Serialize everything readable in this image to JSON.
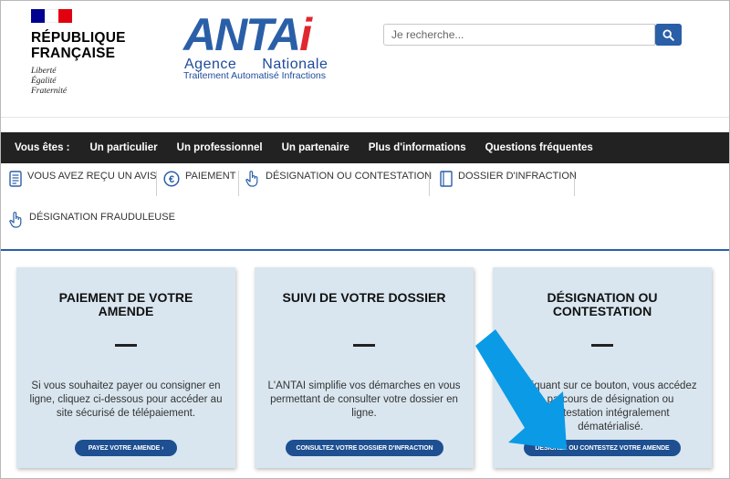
{
  "header": {
    "republique": {
      "line1": "RÉPUBLIQUE",
      "line2": "FRANÇAISE",
      "motto": [
        "Liberté",
        "Égalité",
        "Fraternité"
      ],
      "flag_colors": [
        "#000091",
        "#ffffff",
        "#e1000f"
      ]
    },
    "antai": {
      "word_blue": "ANTA",
      "word_red": "i",
      "sub1_a": "Agence",
      "sub1_b": "Nationale",
      "sub2": "Traitement Automatisé Infractions"
    },
    "search": {
      "placeholder": "Je recherche...",
      "icon": "search-icon"
    }
  },
  "topnav": {
    "label": "Vous êtes :",
    "items": [
      "Un particulier",
      "Un professionnel",
      "Un partenaire",
      "Plus d'informations",
      "Questions fréquentes"
    ]
  },
  "subnav": {
    "items": [
      {
        "label": "VOUS AVEZ REÇU UN AVIS",
        "icon": "document-icon"
      },
      {
        "label": "PAIEMENT",
        "icon": "euro-icon"
      },
      {
        "label": "DÉSIGNATION OU CONTESTATION",
        "icon": "hand-pointer-icon"
      },
      {
        "label": "DOSSIER D'INFRACTION",
        "icon": "folder-icon"
      },
      {
        "label": "DÉSIGNATION FRAUDULEUSE",
        "icon": "hand-pointer-icon"
      }
    ]
  },
  "cards": [
    {
      "title": "PAIEMENT DE VOTRE AMENDE",
      "text": "Si vous souhaitez payer ou consigner en ligne, cliquez ci-dessous pour accéder au site sécurisé de télépaiement.",
      "button": "PAYEZ VOTRE AMENDE  ›"
    },
    {
      "title": "SUIVI DE VOTRE DOSSIER",
      "text": "L'ANTAI simplifie vos démarches en vous permettant de consulter votre dossier en ligne.",
      "button": "CONSULTEZ VOTRE DOSSIER D'INFRACTION"
    },
    {
      "title": "DÉSIGNATION OU CONTESTATION",
      "text": "cliquant sur ce bouton, vous accédez parcours de désignation ou ontestation intégralement dématérialisé.",
      "button": "DÉSIGNEZ OU CONTESTEZ VOTRE AMENDE"
    }
  ],
  "colors": {
    "brand_blue": "#2a5fa8",
    "nav_black": "#222222",
    "card_bg": "#d9e6ef",
    "button_blue": "#1d4f91",
    "arrow_blue": "#0b9ae6"
  }
}
